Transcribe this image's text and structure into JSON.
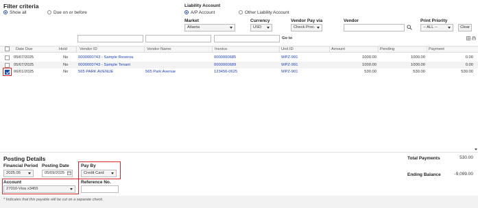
{
  "filter": {
    "title": "Filter criteria",
    "show_all": "Show all",
    "due_on_or_before": "Due on or before",
    "liability_title": "Liability Account",
    "ap_account": "A/P Account",
    "other_liability": "Other Liability Account"
  },
  "fields": {
    "market_label": "Market",
    "market_value": "Atlanta",
    "currency_label": "Currency",
    "currency_value": "USD",
    "vendor_pay_via_label": "Vendor Pay via",
    "vendor_pay_via_value": "Check Proc.",
    "vendor_label": "Vendor",
    "vendor_value": "",
    "print_priority_label": "Print Priority",
    "print_priority_value": "-- ALL --",
    "clear_button": "Clear",
    "goto_button": "Go to"
  },
  "table": {
    "columns": [
      "Date Due",
      "Hold",
      "Vendor ID",
      "Vendor Name",
      "Invoice",
      "Unit ID",
      "Amount",
      "Pending",
      "Payment"
    ],
    "rows": [
      {
        "checked": false,
        "date": "05/07/2025",
        "hold": "No",
        "vendor_id": "0000000743 - Sample Reserva",
        "vendor_name": "",
        "invoice": "0000000685",
        "unit": "WPZ-991",
        "amount": "1000.00",
        "pending": "1000.00",
        "payment": "0.00"
      },
      {
        "checked": false,
        "date": "05/07/2025",
        "hold": "No",
        "vendor_id": "0000000743 - Sample Tenant",
        "vendor_name": "",
        "invoice": "0000000689",
        "unit": "WPZ-991",
        "amount": "1000.00",
        "pending": "1000.00",
        "payment": "0.00"
      },
      {
        "checked": true,
        "date": "06/01/2025",
        "hold": "No",
        "vendor_id": "565 PARK AVENUE",
        "vendor_name": "565 Park Avenue",
        "invoice": "123456-0625",
        "unit": "WPZ-901",
        "amount": "530.00",
        "pending": "530.00",
        "payment": "530.00"
      }
    ]
  },
  "posting": {
    "title": "Posting Details",
    "financial_period_label": "Financial Period",
    "financial_period_value": "2025.05",
    "posting_date_label": "Posting Date",
    "posting_date_value": "05/09/2025",
    "pay_by_label": "Pay By",
    "pay_by_value": "Credit Card",
    "account_label": "Account",
    "account_value": "27010-Visa x3455",
    "reference_label": "Reference No.",
    "reference_value": "",
    "total_payments_label": "Total Payments",
    "total_payments_value": "530.00",
    "ending_balance_label": "Ending Balance",
    "ending_balance_value": "-9,099.00"
  },
  "footer_note": "* Indicates that this payable will be cut on a separate check.",
  "colors": {
    "link": "#1a3fc4",
    "highlight": "#d8262e",
    "accent": "#1a4fb4"
  }
}
